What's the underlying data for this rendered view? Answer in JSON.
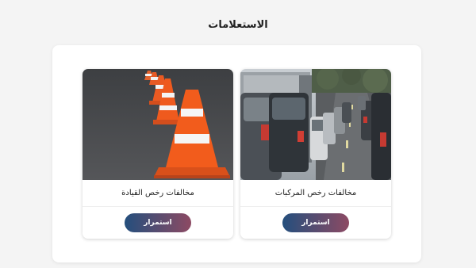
{
  "page": {
    "title": "الاستعلامات"
  },
  "cards": [
    {
      "title": "مخالفات رخص المركبات",
      "button_label": "استمرار",
      "image": "traffic-jam-image"
    },
    {
      "title": "مخالفات رخص القيادة",
      "button_label": "استمرار",
      "image": "traffic-cones-image"
    }
  ],
  "colors": {
    "button_gradient_start": "#244f7d",
    "button_gradient_end": "#8d4a63",
    "background": "#f4f4f4"
  }
}
